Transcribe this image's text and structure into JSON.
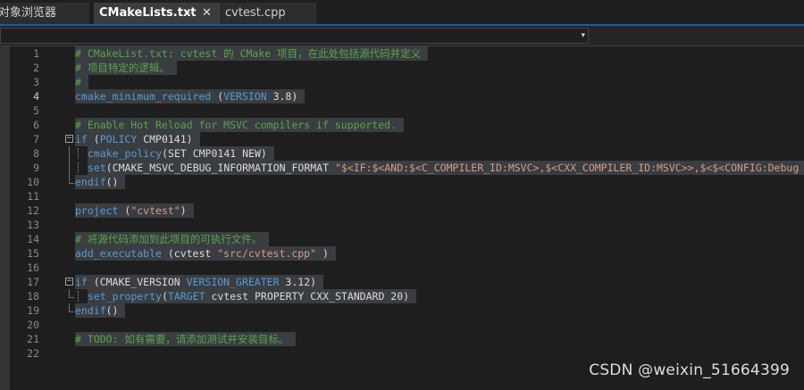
{
  "tabs": [
    {
      "label": "对象浏览器",
      "active": false
    },
    {
      "label": "CMakeLists.txt",
      "active": true,
      "pin_glyph": "⊣",
      "close_glyph": "✕"
    },
    {
      "label": "cvtest.cpp",
      "active": false
    }
  ],
  "navbar": {
    "dropdown_arrow": "▾"
  },
  "editor": {
    "current_line": 4,
    "colors": {
      "keyword": "#569cd6",
      "comment": "#57a64a",
      "string": "#d69d85",
      "text": "#dcdcdc"
    },
    "lines": [
      {
        "n": "1",
        "text": "# CMakeList.txt: cvtest 的 CMake 项目，在此处包括源代码并定义"
      },
      {
        "n": "2",
        "text": "# 项目特定的逻辑。"
      },
      {
        "n": "3",
        "text": "#"
      },
      {
        "n": "4",
        "kw": "cmake_minimum_required",
        "t1": " (",
        "kw2": "VERSION",
        "t2": " 3.8)"
      },
      {
        "n": "5"
      },
      {
        "n": "6",
        "text": "# Enable Hot Reload for MSVC compilers if supported."
      },
      {
        "n": "7",
        "kw": "if",
        "t1": " (",
        "kw2": "POLICY",
        "t2": " CMP0141)",
        "fold": "−"
      },
      {
        "n": "8",
        "kw": "cmake_policy",
        "t1": "(SET CMP0141 NEW)"
      },
      {
        "n": "9",
        "kw": "set",
        "t1": "(CMAKE_MSVC_DEBUG_INFORMATION_FORMAT ",
        "str": "\"$<IF:$<AND:$<C_COMPILER_ID:MSVC>,$<CXX_COMPILER_ID:MSVC>>,$<$<CONFIG:Debug"
      },
      {
        "n": "10",
        "kw": "endif",
        "t1": "()"
      },
      {
        "n": "11"
      },
      {
        "n": "12",
        "kw": "project",
        "t1": " (",
        "str": "\"cvtest\"",
        "t2": ")"
      },
      {
        "n": "13"
      },
      {
        "n": "14",
        "text": "# 将源代码添加到此项目的可执行文件。"
      },
      {
        "n": "15",
        "kw": "add_executable",
        "t1": " (cvtest ",
        "str": "\"src/cvtest.cpp\"",
        "t2": " )"
      },
      {
        "n": "16"
      },
      {
        "n": "17",
        "kw": "if",
        "t1": " (CMAKE_VERSION ",
        "kw2": "VERSION_GREATER",
        "t2": " 3.12)",
        "fold": "−"
      },
      {
        "n": "18",
        "kw": "set_property",
        "t1": "(",
        "kw2": "TARGET",
        "t2": " cvtest PROPERTY CXX_STANDARD 20)"
      },
      {
        "n": "19",
        "kw": "endif",
        "t1": "()"
      },
      {
        "n": "20"
      },
      {
        "n": "21",
        "text": "# TODO: 如有需要，请添加测试并安装目标。"
      },
      {
        "n": "22"
      }
    ]
  },
  "watermark": "CSDN @weixin_51664399"
}
